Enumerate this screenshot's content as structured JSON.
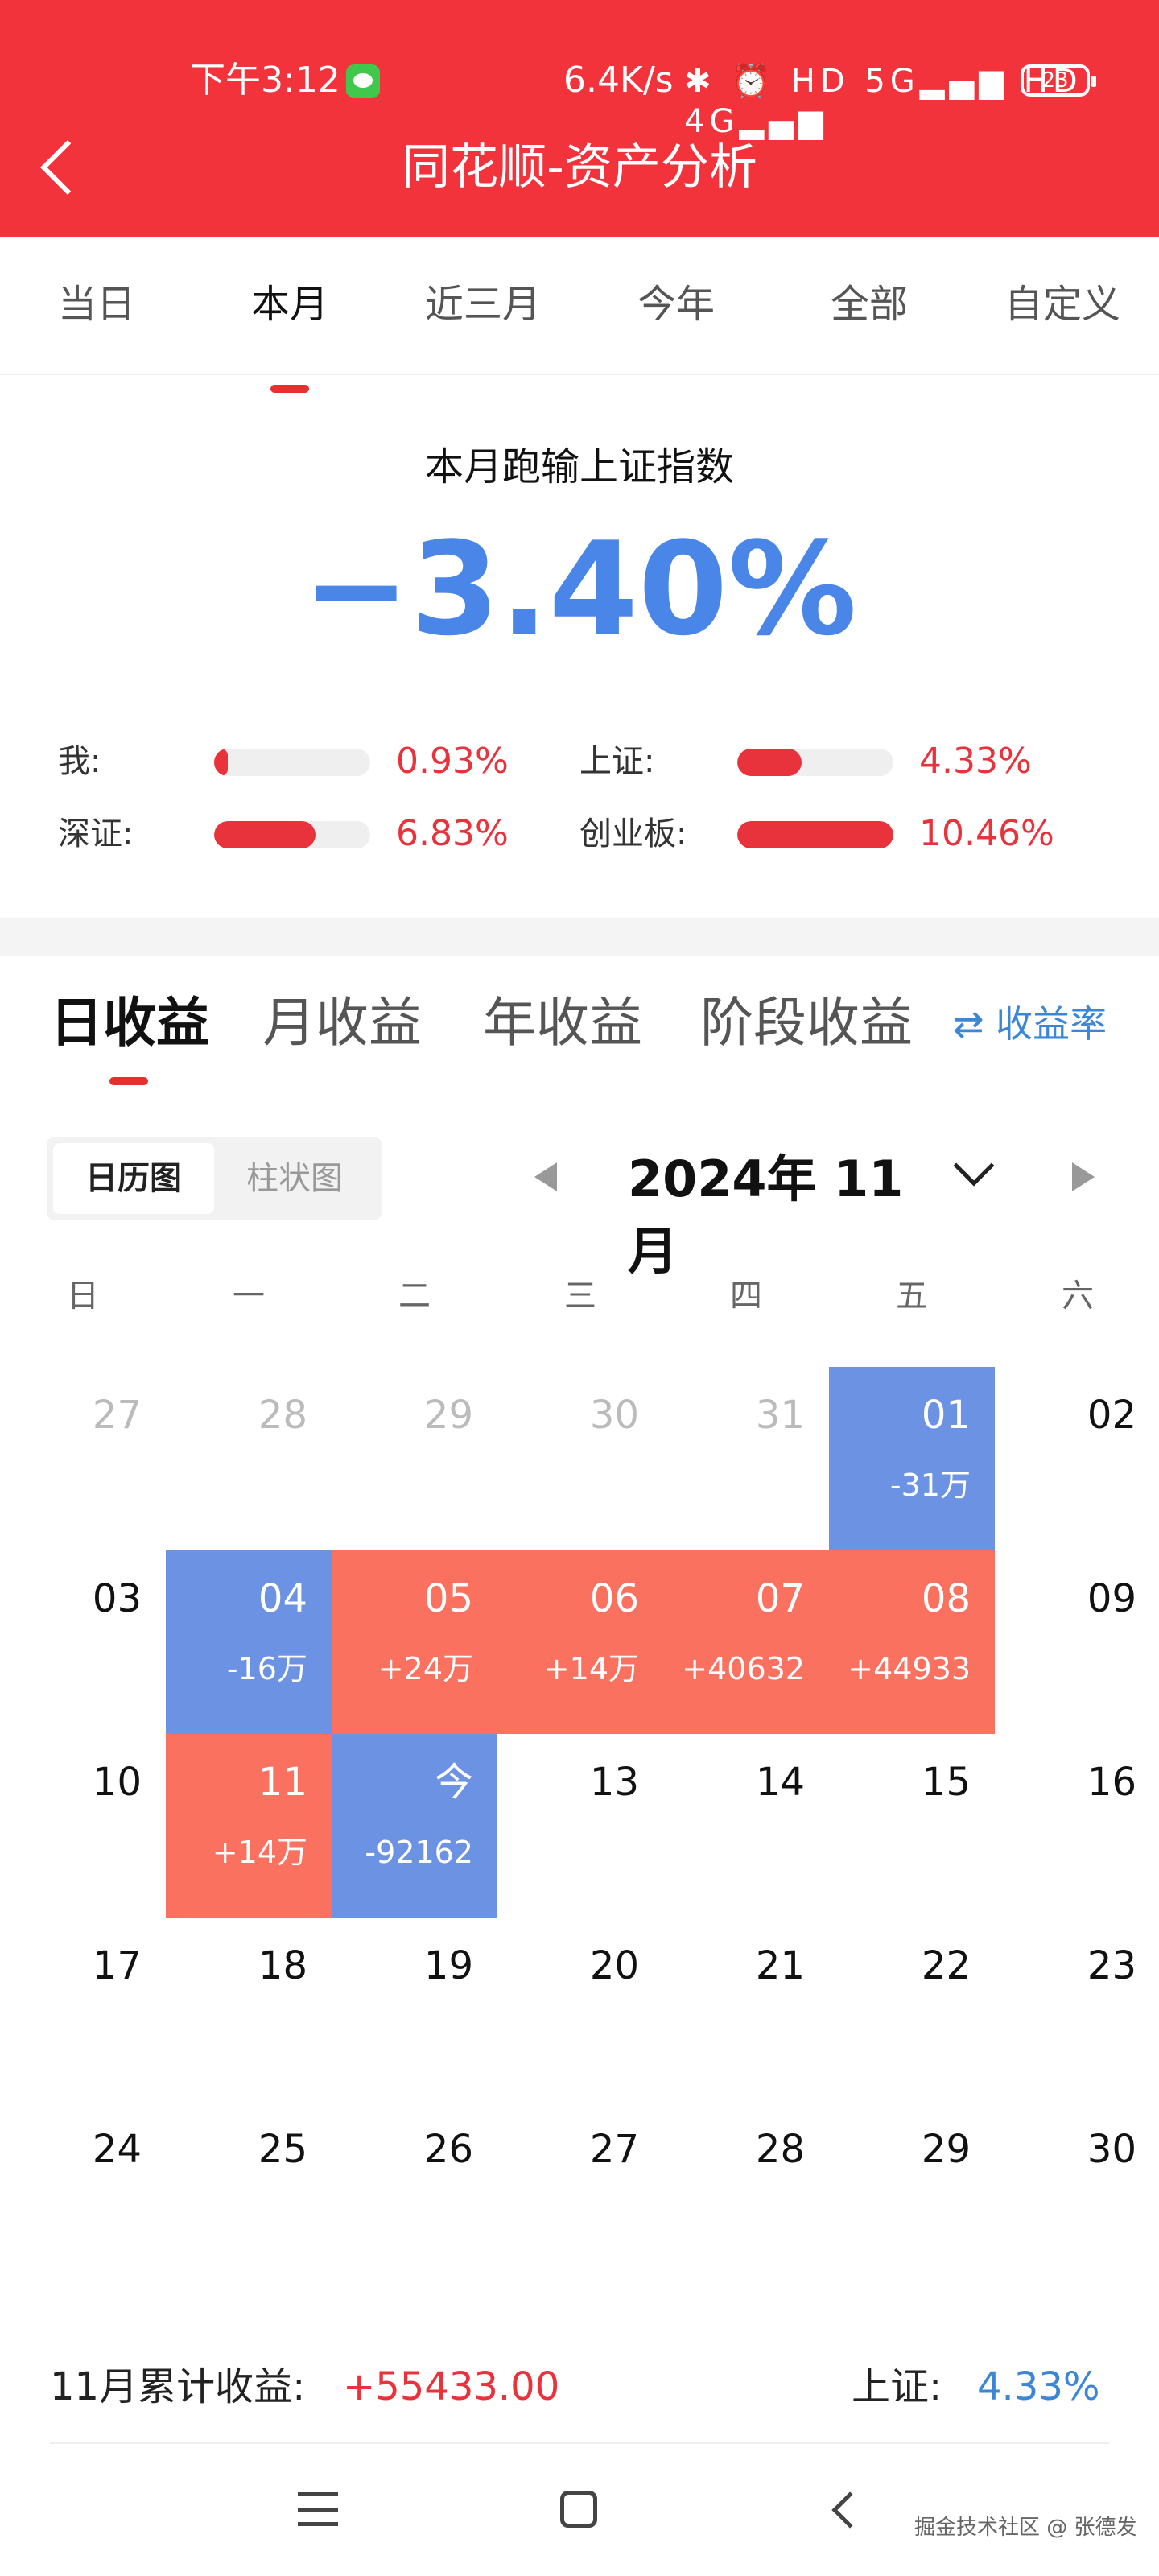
{
  "status_bar": {
    "time": "下午3:12",
    "network_speed": "6.4K/s",
    "icons_text": "✱ ⏰ HD 5G▂▄▆ HD 4G▂▄▆",
    "battery": "23"
  },
  "header": {
    "title": "同花顺-资产分析"
  },
  "period_tabs": [
    "当日",
    "本月",
    "近三月",
    "今年",
    "全部",
    "自定义"
  ],
  "summary": {
    "caption": "本月跑输上证指数",
    "value": "−3.40%"
  },
  "comparisons": [
    {
      "label": "我:",
      "value": "0.93%",
      "fraction": 0.09
    },
    {
      "label": "上证:",
      "value": "4.33%",
      "fraction": 0.41
    },
    {
      "label": "深证:",
      "value": "6.83%",
      "fraction": 0.65
    },
    {
      "label": "创业板:",
      "value": "10.46%",
      "fraction": 1.0
    }
  ],
  "income_tabs": [
    "日收益",
    "月收益",
    "年收益",
    "阶段收益"
  ],
  "rate_toggle": "⇄ 收益率",
  "view_switch": [
    "日历图",
    "柱状图"
  ],
  "month": "2024年 11月",
  "weekdays": [
    "日",
    "一",
    "二",
    "三",
    "四",
    "五",
    "六"
  ],
  "calendar": [
    {
      "day": "27",
      "amount": "",
      "state": "muted"
    },
    {
      "day": "28",
      "amount": "",
      "state": "muted"
    },
    {
      "day": "29",
      "amount": "",
      "state": "muted"
    },
    {
      "day": "30",
      "amount": "",
      "state": "muted"
    },
    {
      "day": "31",
      "amount": "",
      "state": "muted"
    },
    {
      "day": "01",
      "amount": "-31万",
      "state": "neg"
    },
    {
      "day": "02",
      "amount": "",
      "state": "plain"
    },
    {
      "day": "03",
      "amount": "",
      "state": "plain"
    },
    {
      "day": "04",
      "amount": "-16万",
      "state": "neg"
    },
    {
      "day": "05",
      "amount": "+24万",
      "state": "pos"
    },
    {
      "day": "06",
      "amount": "+14万",
      "state": "pos"
    },
    {
      "day": "07",
      "amount": "+40632",
      "state": "pos"
    },
    {
      "day": "08",
      "amount": "+44933",
      "state": "pos"
    },
    {
      "day": "09",
      "amount": "",
      "state": "plain"
    },
    {
      "day": "10",
      "amount": "",
      "state": "plain"
    },
    {
      "day": "11",
      "amount": "+14万",
      "state": "pos"
    },
    {
      "day": "今",
      "amount": "-92162",
      "state": "neg"
    },
    {
      "day": "13",
      "amount": "",
      "state": "plain"
    },
    {
      "day": "14",
      "amount": "",
      "state": "plain"
    },
    {
      "day": "15",
      "amount": "",
      "state": "plain"
    },
    {
      "day": "16",
      "amount": "",
      "state": "plain"
    },
    {
      "day": "17",
      "amount": "",
      "state": "plain"
    },
    {
      "day": "18",
      "amount": "",
      "state": "plain"
    },
    {
      "day": "19",
      "amount": "",
      "state": "plain"
    },
    {
      "day": "20",
      "amount": "",
      "state": "plain"
    },
    {
      "day": "21",
      "amount": "",
      "state": "plain"
    },
    {
      "day": "22",
      "amount": "",
      "state": "plain"
    },
    {
      "day": "23",
      "amount": "",
      "state": "plain"
    },
    {
      "day": "24",
      "amount": "",
      "state": "plain"
    },
    {
      "day": "25",
      "amount": "",
      "state": "plain"
    },
    {
      "day": "26",
      "amount": "",
      "state": "plain"
    },
    {
      "day": "27",
      "amount": "",
      "state": "plain"
    },
    {
      "day": "28",
      "amount": "",
      "state": "plain"
    },
    {
      "day": "29",
      "amount": "",
      "state": "plain"
    },
    {
      "day": "30",
      "amount": "",
      "state": "plain"
    }
  ],
  "footer": {
    "cumulative_label": "11月累计收益:",
    "cumulative_value": "+55433.00",
    "index_label": "上证:",
    "index_value": "4.33%"
  },
  "watermark": "掘金技术社区 @ 张德发",
  "colors": {
    "brand_red": "#f2333c",
    "gain": "#fb7160",
    "loss": "#6c92e4",
    "accent_blue": "#4a86e8"
  }
}
